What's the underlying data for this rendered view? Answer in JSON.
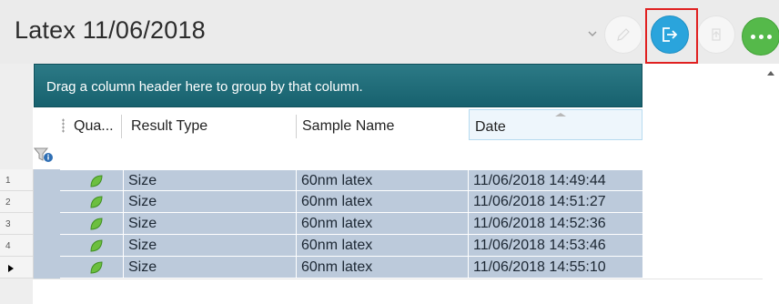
{
  "header": {
    "title": "Latex 11/06/2018",
    "actions": [
      {
        "name": "edit-button",
        "icon": "pencil-icon",
        "color": "#f6f6f6"
      },
      {
        "name": "export-button",
        "icon": "export-icon",
        "color": "#2aa4dc"
      },
      {
        "name": "share-button",
        "icon": "share-icon",
        "color": "#f6f6f6"
      },
      {
        "name": "more-button",
        "icon": "more-icon",
        "color": "#55b94a"
      }
    ]
  },
  "grid": {
    "group_panel_text": "Drag a column header here to group by that column.",
    "columns": [
      {
        "key": "quality",
        "label": "Qua..."
      },
      {
        "key": "result_type",
        "label": "Result Type"
      },
      {
        "key": "sample_name",
        "label": "Sample Name"
      },
      {
        "key": "date",
        "label": "Date"
      }
    ],
    "sorted_column": "date",
    "filter_icon": "filter-info-icon",
    "rows": [
      {
        "row_label": "1",
        "quality_icon": "green-leaf-icon",
        "result_type": "Size",
        "sample_name": "60nm latex",
        "date": "11/06/2018 14:49:44"
      },
      {
        "row_label": "2",
        "quality_icon": "green-leaf-icon",
        "result_type": "Size",
        "sample_name": "60nm latex",
        "date": "11/06/2018 14:51:27"
      },
      {
        "row_label": "3",
        "quality_icon": "green-leaf-icon",
        "result_type": "Size",
        "sample_name": "60nm latex",
        "date": "11/06/2018 14:52:36"
      },
      {
        "row_label": "4",
        "quality_icon": "green-leaf-icon",
        "result_type": "Size",
        "sample_name": "60nm latex",
        "date": "11/06/2018 14:53:46"
      },
      {
        "row_label": "",
        "quality_icon": "green-leaf-icon",
        "result_type": "Size",
        "sample_name": "60nm latex",
        "date": "11/06/2018 14:55:10",
        "current": true
      }
    ]
  },
  "colors": {
    "accent_blue": "#2aa4dc",
    "accent_green": "#55b94a",
    "highlight_red": "#e02020",
    "group_panel": "#17616e",
    "selected_row": "#bccadb"
  }
}
